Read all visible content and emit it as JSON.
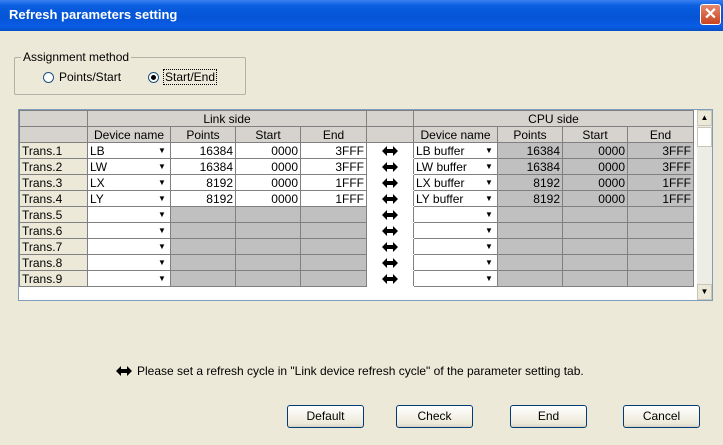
{
  "window": {
    "title": "Refresh parameters setting"
  },
  "assignment": {
    "legend": "Assignment method",
    "option1": "Points/Start",
    "option2": "Start/End",
    "selected": "Start/End"
  },
  "table": {
    "link_side_label": "Link side",
    "cpu_side_label": "CPU side",
    "columns": [
      "Device name",
      "Points",
      "Start",
      "End"
    ],
    "rows": [
      {
        "name": "Trans.1",
        "link_dev": "LB",
        "link_points": "16384",
        "link_start": "0000",
        "link_end": "3FFF",
        "cpu_dev": "LB buffer",
        "cpu_points": "16384",
        "cpu_start": "0000",
        "cpu_end": "3FFF"
      },
      {
        "name": "Trans.2",
        "link_dev": "LW",
        "link_points": "16384",
        "link_start": "0000",
        "link_end": "3FFF",
        "cpu_dev": "LW buffer",
        "cpu_points": "16384",
        "cpu_start": "0000",
        "cpu_end": "3FFF"
      },
      {
        "name": "Trans.3",
        "link_dev": "LX",
        "link_points": "8192",
        "link_start": "0000",
        "link_end": "1FFF",
        "cpu_dev": "LX buffer",
        "cpu_points": "8192",
        "cpu_start": "0000",
        "cpu_end": "1FFF"
      },
      {
        "name": "Trans.4",
        "link_dev": "LY",
        "link_points": "8192",
        "link_start": "0000",
        "link_end": "1FFF",
        "cpu_dev": "LY buffer",
        "cpu_points": "8192",
        "cpu_start": "0000",
        "cpu_end": "1FFF"
      },
      {
        "name": "Trans.5",
        "link_dev": "",
        "link_points": "",
        "link_start": "",
        "link_end": "",
        "cpu_dev": "",
        "cpu_points": "",
        "cpu_start": "",
        "cpu_end": ""
      },
      {
        "name": "Trans.6",
        "link_dev": "",
        "link_points": "",
        "link_start": "",
        "link_end": "",
        "cpu_dev": "",
        "cpu_points": "",
        "cpu_start": "",
        "cpu_end": ""
      },
      {
        "name": "Trans.7",
        "link_dev": "",
        "link_points": "",
        "link_start": "",
        "link_end": "",
        "cpu_dev": "",
        "cpu_points": "",
        "cpu_start": "",
        "cpu_end": ""
      },
      {
        "name": "Trans.8",
        "link_dev": "",
        "link_points": "",
        "link_start": "",
        "link_end": "",
        "cpu_dev": "",
        "cpu_points": "",
        "cpu_start": "",
        "cpu_end": ""
      },
      {
        "name": "Trans.9",
        "link_dev": "",
        "link_points": "",
        "link_start": "",
        "link_end": "",
        "cpu_dev": "",
        "cpu_points": "",
        "cpu_start": "",
        "cpu_end": ""
      }
    ]
  },
  "note": "Please set a refresh cycle in \"Link device refresh cycle\" of the parameter setting tab.",
  "buttons": {
    "default": "Default",
    "check": "Check",
    "end": "End",
    "cancel": "Cancel"
  },
  "icons": {
    "transfer": "double-arrow-icon",
    "dropdown": "dropdown-arrow-icon",
    "close": "close-icon"
  },
  "colors": {
    "title_bar": "#0554d6",
    "close_button": "#c9431f",
    "gray_cell": "#c0c0c0",
    "dialog_bg": "#ece9d8"
  }
}
